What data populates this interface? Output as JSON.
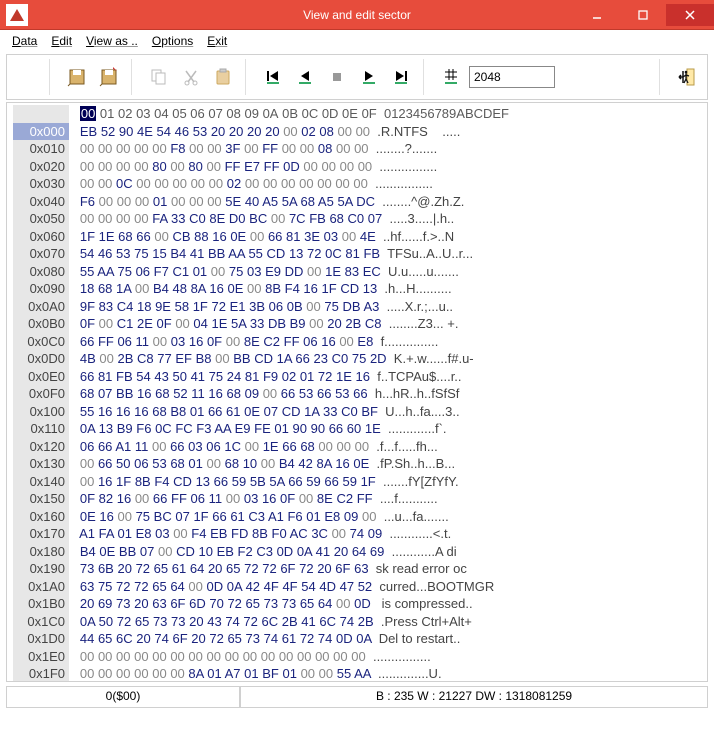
{
  "window": {
    "title": "View and edit sector"
  },
  "menu": {
    "data": "Data",
    "edit": "Edit",
    "viewas": "View as ..",
    "options": "Options",
    "exit": "Exit"
  },
  "toolbar": {
    "sector_input": "2048"
  },
  "header": {
    "cols": "00 01 02 03 04 05 06 07 08 09 0A 0B 0C 0D 0E 0F  0123456789ABCDEF",
    "first": "00"
  },
  "rows": [
    {
      "off": "0x000",
      "hex": "EB 52 90 4E 54 46 53 20 20 20 20 00 02 08 00 00",
      "asc": ".R.NTFS    ....."
    },
    {
      "off": "0x010",
      "hex": "00 00 00 00 00 F8 00 00 3F 00 FF 00 00 08 00 00",
      "asc": "........?......."
    },
    {
      "off": "0x020",
      "hex": "00 00 00 00 80 00 80 00 FF E7 FF 0D 00 00 00 00",
      "asc": "................"
    },
    {
      "off": "0x030",
      "hex": "00 00 0C 00 00 00 00 00 02 00 00 00 00 00 00 00",
      "asc": "................"
    },
    {
      "off": "0x040",
      "hex": "F6 00 00 00 01 00 00 00 5E 40 A5 5A 68 A5 5A DC",
      "asc": "........^@.Zh.Z."
    },
    {
      "off": "0x050",
      "hex": "00 00 00 00 FA 33 C0 8E D0 BC 00 7C FB 68 C0 07",
      "asc": ".....3.....|.h.."
    },
    {
      "off": "0x060",
      "hex": "1F 1E 68 66 00 CB 88 16 0E 00 66 81 3E 03 00 4E",
      "asc": "..hf......f.>..N"
    },
    {
      "off": "0x070",
      "hex": "54 46 53 75 15 B4 41 BB AA 55 CD 13 72 0C 81 FB",
      "asc": "TFSu..A..U..r..."
    },
    {
      "off": "0x080",
      "hex": "55 AA 75 06 F7 C1 01 00 75 03 E9 DD 00 1E 83 EC",
      "asc": "U.u.....u......."
    },
    {
      "off": "0x090",
      "hex": "18 68 1A 00 B4 48 8A 16 0E 00 8B F4 16 1F CD 13",
      "asc": ".h...H.........."
    },
    {
      "off": "0x0A0",
      "hex": "9F 83 C4 18 9E 58 1F 72 E1 3B 06 0B 00 75 DB A3",
      "asc": ".....X.r.;...u.."
    },
    {
      "off": "0x0B0",
      "hex": "0F 00 C1 2E 0F 00 04 1E 5A 33 DB B9 00 20 2B C8",
      "asc": "........Z3... +."
    },
    {
      "off": "0x0C0",
      "hex": "66 FF 06 11 00 03 16 0F 00 8E C2 FF 06 16 00 E8",
      "asc": "f..............."
    },
    {
      "off": "0x0D0",
      "hex": "4B 00 2B C8 77 EF B8 00 BB CD 1A 66 23 C0 75 2D",
      "asc": "K.+.w......f#.u-"
    },
    {
      "off": "0x0E0",
      "hex": "66 81 FB 54 43 50 41 75 24 81 F9 02 01 72 1E 16",
      "asc": "f..TCPAu$....r.."
    },
    {
      "off": "0x0F0",
      "hex": "68 07 BB 16 68 52 11 16 68 09 00 66 53 66 53 66",
      "asc": "h...hR..h..fSfSf"
    },
    {
      "off": "0x100",
      "hex": "55 16 16 16 68 B8 01 66 61 0E 07 CD 1A 33 C0 BF",
      "asc": "U...h..fa....3.."
    },
    {
      "off": "0x110",
      "hex": "0A 13 B9 F6 0C FC F3 AA E9 FE 01 90 90 66 60 1E",
      "asc": ".............f`."
    },
    {
      "off": "0x120",
      "hex": "06 66 A1 11 00 66 03 06 1C 00 1E 66 68 00 00 00",
      "asc": ".f...f.....fh..."
    },
    {
      "off": "0x130",
      "hex": "00 66 50 06 53 68 01 00 68 10 00 B4 42 8A 16 0E",
      "asc": ".fP.Sh..h...B..."
    },
    {
      "off": "0x140",
      "hex": "00 16 1F 8B F4 CD 13 66 59 5B 5A 66 59 66 59 1F",
      "asc": ".......fY[ZfYfY."
    },
    {
      "off": "0x150",
      "hex": "0F 82 16 00 66 FF 06 11 00 03 16 0F 00 8E C2 FF",
      "asc": "....f..........."
    },
    {
      "off": "0x160",
      "hex": "0E 16 00 75 BC 07 1F 66 61 C3 A1 F6 01 E8 09 00",
      "asc": "...u...fa......."
    },
    {
      "off": "0x170",
      "hex": "A1 FA 01 E8 03 00 F4 EB FD 8B F0 AC 3C 00 74 09",
      "asc": "............<.t."
    },
    {
      "off": "0x180",
      "hex": "B4 0E BB 07 00 CD 10 EB F2 C3 0D 0A 41 20 64 69",
      "asc": "............A di"
    },
    {
      "off": "0x190",
      "hex": "73 6B 20 72 65 61 64 20 65 72 72 6F 72 20 6F 63",
      "asc": "sk read error oc"
    },
    {
      "off": "0x1A0",
      "hex": "63 75 72 72 65 64 00 0D 0A 42 4F 4F 54 4D 47 52",
      "asc": "curred...BOOTMGR"
    },
    {
      "off": "0x1B0",
      "hex": "20 69 73 20 63 6F 6D 70 72 65 73 73 65 64 00 0D",
      "asc": " is compressed.."
    },
    {
      "off": "0x1C0",
      "hex": "0A 50 72 65 73 73 20 43 74 72 6C 2B 41 6C 74 2B",
      "asc": ".Press Ctrl+Alt+"
    },
    {
      "off": "0x1D0",
      "hex": "44 65 6C 20 74 6F 20 72 65 73 74 61 72 74 0D 0A",
      "asc": "Del to restart.."
    },
    {
      "off": "0x1E0",
      "hex": "00 00 00 00 00 00 00 00 00 00 00 00 00 00 00 00",
      "asc": "................"
    },
    {
      "off": "0x1F0",
      "hex": "00 00 00 00 00 00 8A 01 A7 01 BF 01 00 00 55 AA",
      "asc": "..............U."
    }
  ],
  "status": {
    "left": "0($00)",
    "right": "B : 235 W : 21227 DW : 1318081259"
  }
}
